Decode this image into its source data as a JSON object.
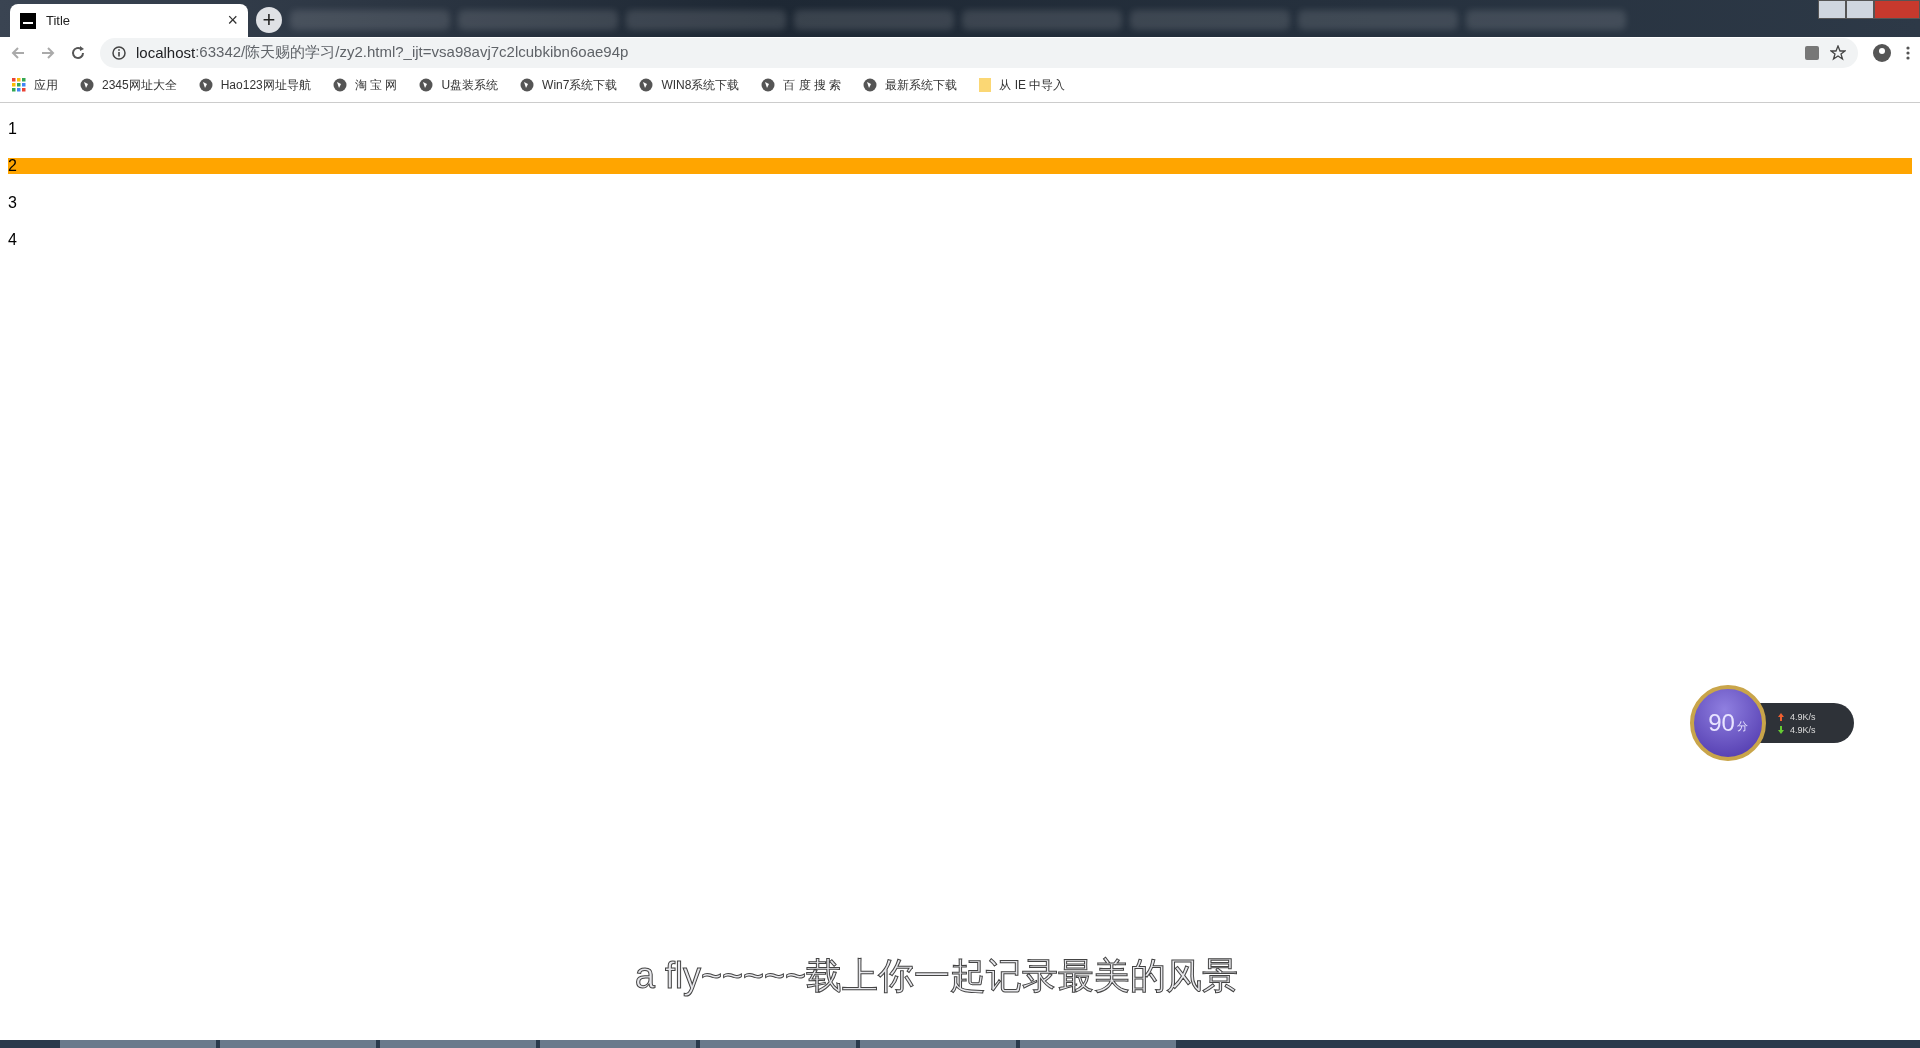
{
  "tab": {
    "title": "Title",
    "close": "×",
    "new_tab": "+"
  },
  "address_bar": {
    "host": "localhost",
    "rest": ":63342/陈天赐的学习/zy2.html?_ijt=vsa98avj7c2lcubkibn6oae94p"
  },
  "bookmarks": [
    {
      "label": "应用",
      "kind": "apps"
    },
    {
      "label": "2345网址大全",
      "kind": "site"
    },
    {
      "label": "Hao123网址导航",
      "kind": "site"
    },
    {
      "label": "淘 宝 网",
      "kind": "site"
    },
    {
      "label": "U盘装系统",
      "kind": "site"
    },
    {
      "label": "Win7系统下载",
      "kind": "site"
    },
    {
      "label": "WIN8系统下载",
      "kind": "site"
    },
    {
      "label": "百 度 搜 索",
      "kind": "site"
    },
    {
      "label": "最新系统下载",
      "kind": "site"
    },
    {
      "label": "从 IE 中导入",
      "kind": "folder"
    }
  ],
  "list": [
    {
      "text": "1",
      "selected": false
    },
    {
      "text": "2",
      "selected": true
    },
    {
      "text": "3",
      "selected": false
    },
    {
      "text": "4",
      "selected": false
    }
  ],
  "speed_widget": {
    "score": "90",
    "unit": "分",
    "upload": "4.9K/s",
    "download": "4.9K/s"
  },
  "lyrics": "a fly~~~~~载上你一起记录最美的风景"
}
